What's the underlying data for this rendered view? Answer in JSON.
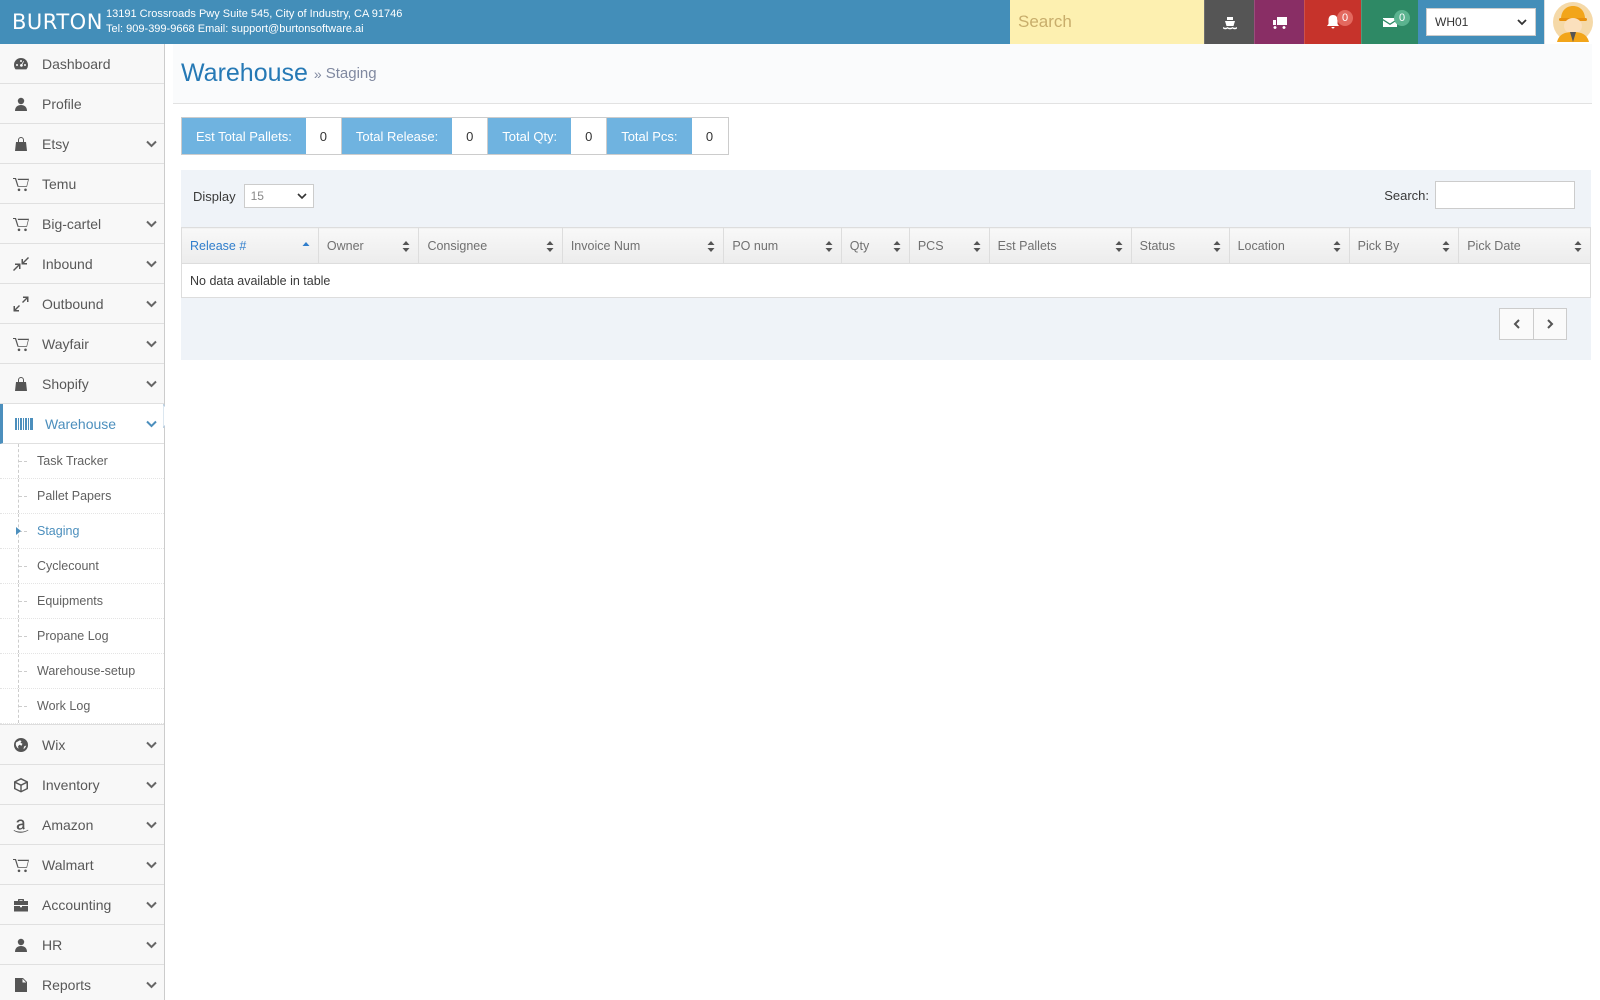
{
  "header": {
    "brand": "BURTON",
    "address_line1": "13191 Crossroads Pwy Suite 545, City of Industry, CA 91746",
    "address_line2": "Tel: 909-399-9668 Email: support@burtonsoftware.ai",
    "search_placeholder": "Search",
    "notifications_count": "0",
    "messages_count": "0",
    "warehouse_selected": "WH01"
  },
  "sidebar": {
    "items": [
      {
        "label": "Dashboard",
        "icon": "dashboard-icon"
      },
      {
        "label": "Profile",
        "icon": "user-icon"
      },
      {
        "label": "Etsy",
        "icon": "shopping-bag-icon"
      },
      {
        "label": "Temu",
        "icon": "cart-icon"
      },
      {
        "label": "Big-cartel",
        "icon": "cart-icon"
      },
      {
        "label": "Inbound",
        "icon": "compress-icon"
      },
      {
        "label": "Outbound",
        "icon": "expand-icon"
      },
      {
        "label": "Wayfair",
        "icon": "cart-icon"
      },
      {
        "label": "Shopify",
        "icon": "shopping-bag-icon"
      },
      {
        "label": "Warehouse",
        "icon": "barcode-icon"
      },
      {
        "label": "Wix",
        "icon": "globe-icon"
      },
      {
        "label": "Inventory",
        "icon": "box-icon"
      },
      {
        "label": "Amazon",
        "icon": "amazon-icon"
      },
      {
        "label": "Walmart",
        "icon": "cart-icon"
      },
      {
        "label": "Accounting",
        "icon": "briefcase-icon"
      },
      {
        "label": "HR",
        "icon": "user-icon"
      },
      {
        "label": "Reports",
        "icon": "file-icon"
      }
    ],
    "warehouse_sub": [
      "Task Tracker",
      "Pallet Papers",
      "Staging",
      "Cyclecount",
      "Equipments",
      "Propane Log",
      "Warehouse-setup",
      "Work Log"
    ]
  },
  "page": {
    "title": "Warehouse",
    "separator": "»",
    "subtitle": "Staging"
  },
  "stats": [
    {
      "label": "Est Total Pallets:",
      "value": "0"
    },
    {
      "label": "Total Release:",
      "value": "0"
    },
    {
      "label": "Total Qty:",
      "value": "0"
    },
    {
      "label": "Total Pcs:",
      "value": "0"
    }
  ],
  "table": {
    "display_label": "Display",
    "display_value": "15",
    "search_label": "Search:",
    "columns": [
      "Release #",
      "Owner",
      "Consignee",
      "Invoice Num",
      "PO num",
      "Qty",
      "PCS",
      "Est Pallets",
      "Status",
      "Location",
      "Pick By",
      "Pick Date"
    ],
    "empty_message": "No data available in table"
  },
  "colors": {
    "header_bg": "#438eb9",
    "accent": "#4c8fbd",
    "stat_label_bg": "#6fb3e0"
  }
}
